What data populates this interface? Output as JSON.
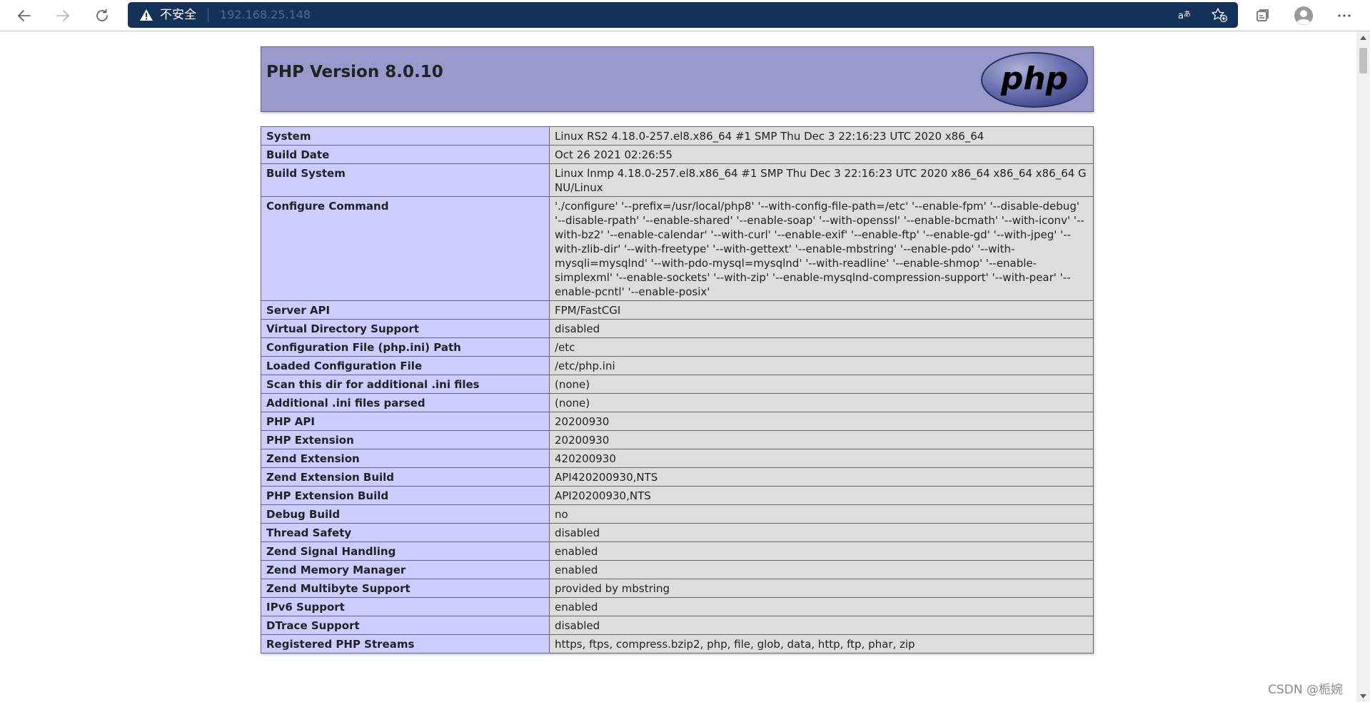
{
  "browser": {
    "security_label": "不安全",
    "url": "192.168.25.148"
  },
  "page": {
    "title": "PHP Version 8.0.10",
    "logo_text": "php"
  },
  "rows": [
    {
      "key": "System",
      "value": "Linux RS2 4.18.0-257.el8.x86_64 #1 SMP Thu Dec 3 22:16:23 UTC 2020 x86_64"
    },
    {
      "key": "Build Date",
      "value": "Oct 26 2021 02:26:55"
    },
    {
      "key": "Build System",
      "value": "Linux lnmp 4.18.0-257.el8.x86_64 #1 SMP Thu Dec 3 22:16:23 UTC 2020 x86_64 x86_64 x86_64 GNU/Linux"
    },
    {
      "key": "Configure Command",
      "value": "'./configure' '--prefix=/usr/local/php8' '--with-config-file-path=/etc' '--enable-fpm' '--disable-debug' '--disable-rpath' '--enable-shared' '--enable-soap' '--with-openssl' '--enable-bcmath' '--with-iconv' '--with-bz2' '--enable-calendar' '--with-curl' '--enable-exif' '--enable-ftp' '--enable-gd' '--with-jpeg' '--with-zlib-dir' '--with-freetype' '--with-gettext' '--enable-mbstring' '--enable-pdo' '--with-mysqli=mysqlnd' '--with-pdo-mysql=mysqlnd' '--with-readline' '--enable-shmop' '--enable-simplexml' '--enable-sockets' '--with-zip' '--enable-mysqlnd-compression-support' '--with-pear' '--enable-pcntl' '--enable-posix'"
    },
    {
      "key": "Server API",
      "value": "FPM/FastCGI"
    },
    {
      "key": "Virtual Directory Support",
      "value": "disabled"
    },
    {
      "key": "Configuration File (php.ini) Path",
      "value": "/etc"
    },
    {
      "key": "Loaded Configuration File",
      "value": "/etc/php.ini"
    },
    {
      "key": "Scan this dir for additional .ini files",
      "value": "(none)"
    },
    {
      "key": "Additional .ini files parsed",
      "value": "(none)"
    },
    {
      "key": "PHP API",
      "value": "20200930"
    },
    {
      "key": "PHP Extension",
      "value": "20200930"
    },
    {
      "key": "Zend Extension",
      "value": "420200930"
    },
    {
      "key": "Zend Extension Build",
      "value": "API420200930,NTS"
    },
    {
      "key": "PHP Extension Build",
      "value": "API20200930,NTS"
    },
    {
      "key": "Debug Build",
      "value": "no"
    },
    {
      "key": "Thread Safety",
      "value": "disabled"
    },
    {
      "key": "Zend Signal Handling",
      "value": "enabled"
    },
    {
      "key": "Zend Memory Manager",
      "value": "enabled"
    },
    {
      "key": "Zend Multibyte Support",
      "value": "provided by mbstring"
    },
    {
      "key": "IPv6 Support",
      "value": "enabled"
    },
    {
      "key": "DTrace Support",
      "value": "disabled"
    },
    {
      "key": "Registered PHP Streams",
      "value": "https, ftps, compress.bzip2, php, file, glob, data, http, ftp, phar, zip"
    }
  ],
  "watermark": "CSDN @栀婉",
  "colors": {
    "header_bg": "#9999cc",
    "key_bg": "#ccccff",
    "value_bg": "#dddddd",
    "address_bar_bg": "#14315a"
  },
  "icons": [
    "back-arrow-icon",
    "forward-arrow-icon",
    "refresh-icon",
    "warning-icon",
    "read-aloud-icon",
    "add-favorite-icon",
    "collections-icon",
    "profile-icon",
    "more-icon"
  ]
}
